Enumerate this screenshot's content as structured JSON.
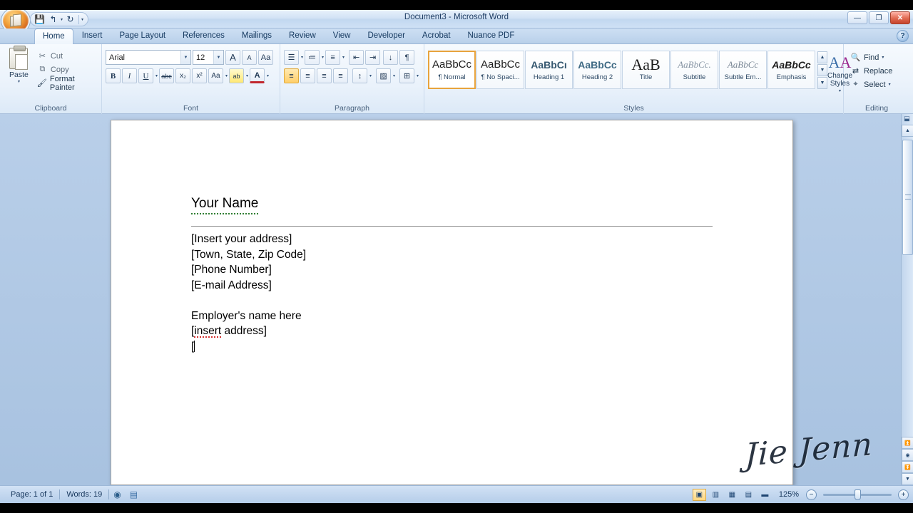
{
  "window": {
    "title": "Document3 - Microsoft Word",
    "controls": {
      "minimize": "—",
      "restore": "❐",
      "close": "✕"
    },
    "help": "?"
  },
  "quick_access": {
    "save": "💾",
    "undo": "↰",
    "redo": "↻",
    "customize": "▾"
  },
  "tabs": [
    {
      "label": "Home",
      "active": true
    },
    {
      "label": "Insert",
      "active": false
    },
    {
      "label": "Page Layout",
      "active": false
    },
    {
      "label": "References",
      "active": false
    },
    {
      "label": "Mailings",
      "active": false
    },
    {
      "label": "Review",
      "active": false
    },
    {
      "label": "View",
      "active": false
    },
    {
      "label": "Developer",
      "active": false
    },
    {
      "label": "Acrobat",
      "active": false
    },
    {
      "label": "Nuance PDF",
      "active": false
    }
  ],
  "ribbon": {
    "clipboard": {
      "label": "Clipboard",
      "paste": "Paste",
      "cut": "Cut",
      "copy": "Copy",
      "format_painter": "Format Painter",
      "launcher": "⌐"
    },
    "font": {
      "label": "Font",
      "font_name": "Arial",
      "font_size": "12",
      "grow_font": "A",
      "shrink_font": "A",
      "clear_formatting": "Aa",
      "bold": "B",
      "italic": "I",
      "underline": "U",
      "strikethrough": "abc",
      "subscript": "x₂",
      "superscript": "x²",
      "change_case": "Aa",
      "highlight": "ab",
      "font_color": "A",
      "launcher": "⌐"
    },
    "paragraph": {
      "label": "Paragraph",
      "bullets": "☰",
      "numbering": "≔",
      "multilevel": "≡",
      "decrease_indent": "⇤",
      "increase_indent": "⇥",
      "sort": "↓",
      "show_marks": "¶",
      "align_left": "≡",
      "align_center": "≡",
      "align_right": "≡",
      "justify": "≡",
      "line_spacing": "↕",
      "shading": "▨",
      "borders": "⊞",
      "launcher": "⌐"
    },
    "styles": {
      "label": "Styles",
      "items": [
        {
          "preview": "AaBbCc",
          "name": "¶ Normal",
          "selected": true
        },
        {
          "preview": "AaBbCc",
          "name": "¶ No Spaci...",
          "selected": false
        },
        {
          "preview": "AaBbCı",
          "name": "Heading 1",
          "selected": false
        },
        {
          "preview": "AaBbCc",
          "name": "Heading 2",
          "selected": false
        },
        {
          "preview": "AaB",
          "name": "Title",
          "selected": false
        },
        {
          "preview": "AaBbCc.",
          "name": "Subtitle",
          "selected": false
        },
        {
          "preview": "AaBbCc",
          "name": "Subtle Em...",
          "selected": false
        },
        {
          "preview": "AaBbCc",
          "name": "Emphasis",
          "selected": false
        }
      ],
      "scroll_up": "▲",
      "scroll_down": "▼",
      "more": "▼",
      "change_styles": "Change Styles",
      "launcher": "⌐"
    },
    "editing": {
      "label": "Editing",
      "find": "Find",
      "replace": "Replace",
      "select": "Select"
    }
  },
  "document": {
    "name_line": "Your Name",
    "address_lines": [
      "[Insert your address]",
      "[Town, State, Zip Code]",
      "[Phone Number]",
      "[E-mail Address]"
    ],
    "employer_line": "Employer's name here",
    "insert_word": "insert",
    "insert_address_prefix": "[",
    "insert_address_suffix": " address]",
    "cursor_line": "[",
    "watermark": "Jie Jenn"
  },
  "status_bar": {
    "page": "Page: 1 of 1",
    "words": "Words: 19",
    "proofing_icon": "◉",
    "language_icon": "▤",
    "views": [
      {
        "name": "print-layout",
        "glyph": "▣",
        "active": true
      },
      {
        "name": "full-screen-reading",
        "glyph": "▥",
        "active": false
      },
      {
        "name": "web-layout",
        "glyph": "▦",
        "active": false
      },
      {
        "name": "outline",
        "glyph": "▤",
        "active": false
      },
      {
        "name": "draft",
        "glyph": "▬",
        "active": false
      }
    ],
    "zoom": "125%",
    "zoom_out": "−",
    "zoom_in": "+"
  }
}
